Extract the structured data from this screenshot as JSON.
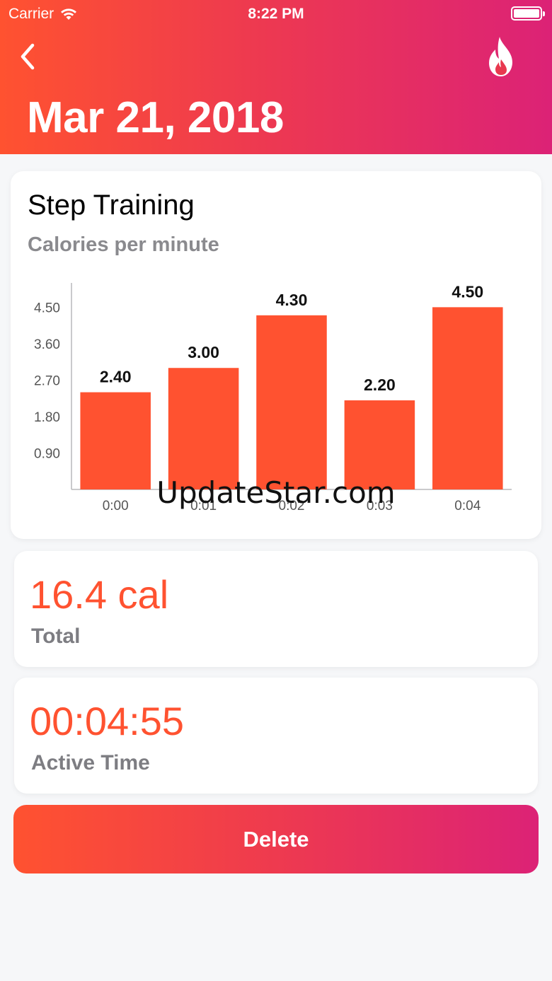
{
  "status_bar": {
    "carrier": "Carrier",
    "time": "8:22 PM"
  },
  "header": {
    "date_title": "Mar 21, 2018"
  },
  "icons": {
    "back": "chevron-left-icon",
    "flame": "flame-icon",
    "wifi": "wifi-icon",
    "battery": "battery-icon"
  },
  "colors": {
    "accent": "#ff5230",
    "gradient_start": "#ff5230",
    "gradient_end": "#dc2276",
    "label_gray": "#7d7d82"
  },
  "workout": {
    "name": "Step Training",
    "metric": "Calories per minute"
  },
  "chart_data": {
    "type": "bar",
    "title": "",
    "xlabel": "",
    "ylabel": "",
    "categories": [
      "0:00",
      "0:01",
      "0:02",
      "0:03",
      "0:04"
    ],
    "values": [
      2.4,
      3.0,
      4.3,
      2.2,
      4.5
    ],
    "value_labels": [
      "2.40",
      "3.00",
      "4.30",
      "2.20",
      "4.50"
    ],
    "y_ticks": [
      "0.90",
      "1.80",
      "2.70",
      "3.60",
      "4.50"
    ],
    "ylim": [
      0,
      5.1
    ],
    "bar_color": "#ff5230",
    "grid": false
  },
  "total": {
    "value": "16.4 cal",
    "label": "Total"
  },
  "active_time": {
    "value": "00:04:55",
    "label": "Active Time"
  },
  "actions": {
    "delete_label": "Delete"
  },
  "watermark": "UpdateStar.com"
}
